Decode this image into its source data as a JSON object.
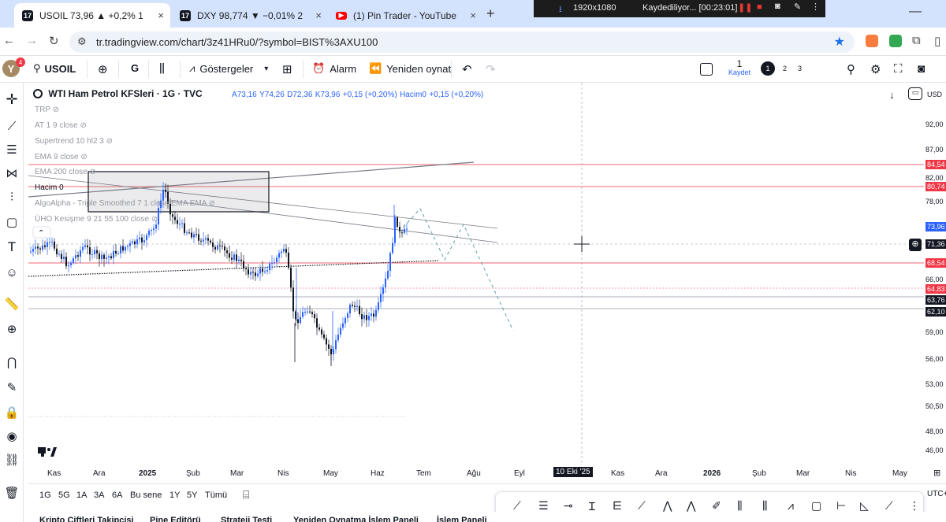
{
  "browser": {
    "tabs": [
      {
        "label": "USOIL 73,96 ▲ +0,2% 1",
        "active": true
      },
      {
        "label": "DXY 98,774 ▼ −0,01% 2",
        "active": false
      },
      {
        "label": "(1) Pin Trader - YouTube",
        "active": false
      }
    ],
    "recorder": {
      "resolution": "1920x1080",
      "status": "Kaydediliyor... [00:23:01]"
    },
    "url": "tr.tradingview.com/chart/3z41HRu0/?symbol=BIST%3AXU100"
  },
  "toolbar": {
    "avatar_letter": "Y",
    "avatar_badge": "4",
    "symbol": "USOIL",
    "interval": "G",
    "indicators": "Göstergeler",
    "alert": "Alarm",
    "replay": "Yeniden oynat",
    "save_count": "1",
    "save_label": "Kaydet",
    "layouts": [
      "1",
      "2",
      "3"
    ],
    "currency": "USD"
  },
  "legend": {
    "title": "WTI Ham Petrol KFSleri · 1G · TVC",
    "o": "A73,16",
    "h": "Y74,26",
    "l": "D72,36",
    "c": "K73,96",
    "change": "+0,15 (+0,20%)",
    "volume": "Hacim0",
    "volume_change": "+0,15 (+0,20%)"
  },
  "indicators": [
    "TRP",
    "AT 1 9 close",
    "Supertrend 10 hl2 3",
    "EMA 9 close",
    "EMA 200 close",
    "Hacim  0",
    "AlgoAlpha - Triple Smoothed 7 1 close EMA EMA",
    "ÜHO Kesişme 9 21 55 100 close"
  ],
  "price_scale": [
    "92,00",
    "87,00",
    "84,54",
    "82,00",
    "80,74",
    "78,00",
    "73,96",
    "71,36",
    "68,54",
    "66,00",
    "64,83",
    "63,76",
    "62,10",
    "59,00",
    "56,00",
    "53,00",
    "50,50",
    "48,00",
    "46,00"
  ],
  "price_tags": [
    {
      "value": "84,54",
      "color": "#f23645"
    },
    {
      "value": "80,74",
      "color": "#f23645"
    },
    {
      "value": "73,96",
      "color": "#2962ff"
    },
    {
      "value": "71,36",
      "color": "#131722"
    },
    {
      "value": "68,54",
      "color": "#f23645"
    },
    {
      "value": "64,83",
      "color": "#f23645"
    },
    {
      "value": "63,76",
      "color": "#131722"
    },
    {
      "value": "62,10",
      "color": "#131722"
    }
  ],
  "time_axis": [
    "Kas",
    "Ara",
    "2025",
    "Şub",
    "Mar",
    "Nis",
    "May",
    "Haz",
    "Tem",
    "Ağu",
    "Eyl",
    "10 Eki '25",
    "Kas",
    "Ara",
    "2026",
    "Şub",
    "Mar",
    "Nis",
    "May"
  ],
  "timezone": "UTC+",
  "ranges": [
    "1G",
    "5G",
    "1A",
    "3A",
    "6A",
    "Bu sene",
    "1Y",
    "5Y",
    "Tümü"
  ],
  "bottom_panels": [
    "Kripto Çiftleri Takipçisi",
    "Pine Editörü",
    "Strateji Testi",
    "Yeniden Oynatma İşlem Paneli",
    "İşlem Paneli"
  ],
  "colors": {
    "up": "#2962ff",
    "down": "#131722",
    "level": "#f23645",
    "accent": "#2962ff"
  }
}
